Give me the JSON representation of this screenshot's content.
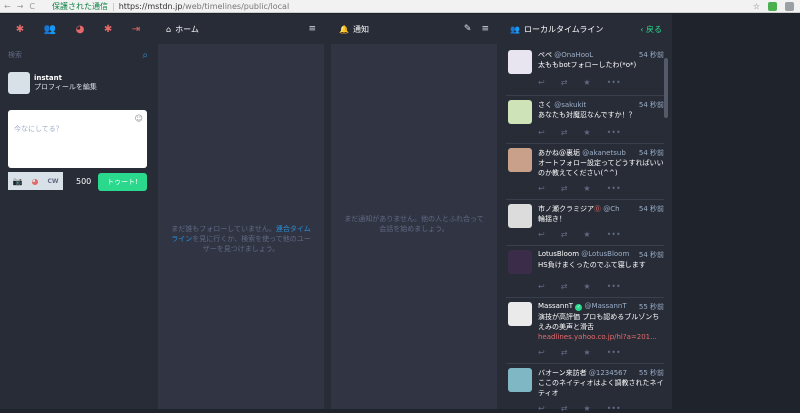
{
  "browser": {
    "back": "←",
    "forward": "→",
    "reload": "C",
    "secure_label": "保護された通信",
    "url_host": "https://mstdn.jp",
    "url_path": "/web/timelines/public/local",
    "star": "☆"
  },
  "drawer": {
    "tabs": [
      "✱",
      "👥",
      "◕",
      "✱",
      "⇥"
    ],
    "search_placeholder": "検索",
    "profile_name": "instant",
    "profile_edit": "プロフィールを編集",
    "compose_placeholder": "今なにしてる？",
    "cw_label": "CW",
    "counter": "500",
    "toot_label": "トゥート!"
  },
  "columns": {
    "home": {
      "title": "ホーム",
      "empty_pre": "まだ誰もフォローしていません。",
      "empty_link": "連合タイムライン",
      "empty_post": "を見に行くか、検索を使って他のユーザーを見つけましょう。"
    },
    "notifications": {
      "title": "通知",
      "empty": "まだ通知がありません。他の人とふれ合って会話を始めましょう。"
    },
    "local": {
      "title": "ローカルタイムライン",
      "back": "戻る"
    }
  },
  "statuses": [
    {
      "display": "ペペ",
      "acct": "@OnaHooL",
      "time": "54 秒前",
      "text": "太ももbotフォローしたわ(*o*)",
      "avatar_color": "#e8e4f0"
    },
    {
      "display": "さく",
      "acct": "@sakukit",
      "time": "54 秒前",
      "text": "あなたも対魔忍なんですか！？",
      "avatar_color": "#cfe3b8"
    },
    {
      "display": "あかね@裏垢",
      "acct": "@akanetsub",
      "time": "54 秒前",
      "text": "オートフォロー設定ってどうすればいいのか教えてください(^^)",
      "avatar_color": "#c9a089"
    },
    {
      "display": "市ノ瀬クラミジア",
      "acct": "@Ch",
      "time": "54 秒前",
      "text": "輪揺き！",
      "avatar_color": "#dcdcdc"
    },
    {
      "display": "LotusBloom",
      "acct": "@LotusBloom",
      "time": "54 秒前",
      "text": "HS負けまくったのでふて寝します",
      "avatar_color": "#3b2d4a"
    },
    {
      "display": "MassannT",
      "acct": "@MassannT",
      "time": "55 秒前",
      "text": "演技が高評価 プロも認めるブルゾンちえみの美声と滑舌",
      "url": "headlines.yahoo.co.jp/hl?a=201...",
      "avatar_color": "#eaeaea"
    },
    {
      "display": "バオーン来訪者",
      "acct": "@1234567",
      "time": "55 秒前",
      "text": "ここのネイティオはよく調教されたネイティオ",
      "avatar_color": "#7fb8c4"
    }
  ],
  "action_icons": {
    "reply": "↩",
    "boost": "⇄",
    "fav": "★",
    "more": "•••"
  }
}
